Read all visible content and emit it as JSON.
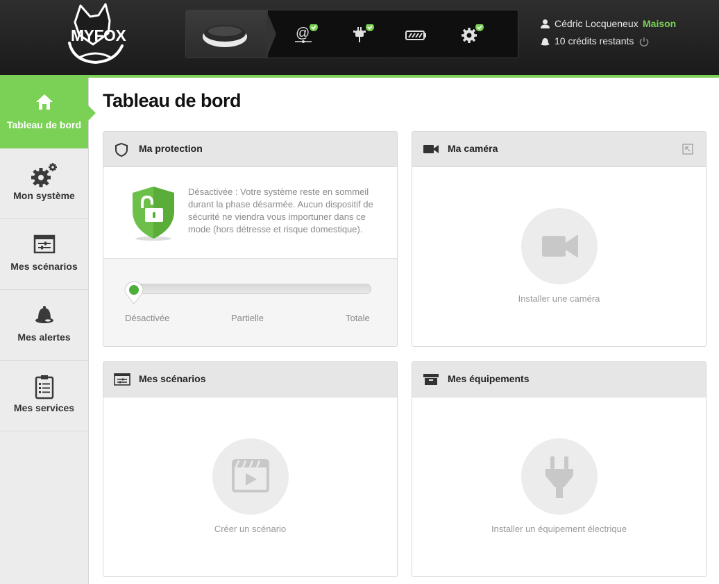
{
  "header": {
    "logo_text": "MYFOX",
    "user_name": "Cédric Locqueneux",
    "site_name": "Maison",
    "credits": "10 crédits restants",
    "status_icons": [
      "device-icon",
      "internet-icon",
      "power-plug-icon",
      "battery-icon",
      "settings-icon"
    ],
    "accent_color": "#7bd156"
  },
  "sidebar": {
    "items": [
      {
        "label": "Tableau de bord",
        "icon": "home-icon",
        "active": true
      },
      {
        "label": "Mon système",
        "icon": "gears-icon",
        "active": false
      },
      {
        "label": "Mes scénarios",
        "icon": "scenario-icon",
        "active": false
      },
      {
        "label": "Mes alertes",
        "icon": "bell-icon",
        "active": false
      },
      {
        "label": "Mes services",
        "icon": "checklist-icon",
        "active": false
      }
    ]
  },
  "main": {
    "title": "Tableau de bord",
    "protection": {
      "title": "Ma protection",
      "description": "Désactivée : Votre système reste en sommeil durant la phase désarmée. Aucun dispositif de sécurité ne viendra vous importuner dans ce mode (hors détresse et risque domestique).",
      "levels": [
        "Désactivée",
        "Partielle",
        "Totale"
      ],
      "current_level": "Désactivée"
    },
    "camera": {
      "title": "Ma caméra",
      "cta": "Installer une caméra"
    },
    "scenarios": {
      "title": "Mes scénarios",
      "cta": "Créer un scénario"
    },
    "equipment": {
      "title": "Mes équipements",
      "cta": "Installer un équipement électrique"
    }
  }
}
